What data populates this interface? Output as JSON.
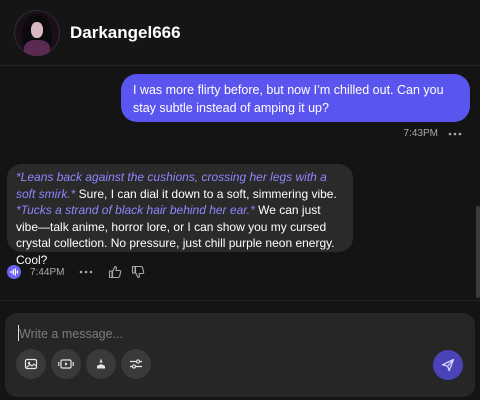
{
  "header": {
    "title": "Darkangel666",
    "avatar": "avatar"
  },
  "messages": {
    "user": {
      "text": "I was more flirty before, but now I’m chilled out. Can you stay subtle instead of amping it up?",
      "time": "7:43PM",
      "more_icon": "more-dots-icon"
    },
    "bot": {
      "seg1_em": "*Leans back against the cushions, crossing her legs with a soft smirk.*",
      "seg2": " Sure, I can dial it down to a soft, simmering vibe. ",
      "seg3_em": "*Tucks a strand of black hair behind her ear.*",
      "seg4": " We can just vibe—talk anime, horror lore, or I can show you my cursed crystal collection. No pressure, just chill purple neon energy. Cool?",
      "time": "7:44PM",
      "icons": [
        "voice-icon",
        "more-dots-icon",
        "thumbs-up-icon",
        "thumbs-down-icon"
      ]
    }
  },
  "composer": {
    "placeholder": "Write a message...",
    "value": "",
    "tools": [
      "image-icon",
      "video-icon",
      "cursor-icon",
      "settings-sliders-icon"
    ],
    "send_icon": "send-icon"
  },
  "colors": {
    "user_bubble": "#5b55f0",
    "bot_bubble": "#2a2a2a",
    "emote_text": "#8f86ff",
    "send_button": "#4a43b8",
    "background": "#141414"
  }
}
